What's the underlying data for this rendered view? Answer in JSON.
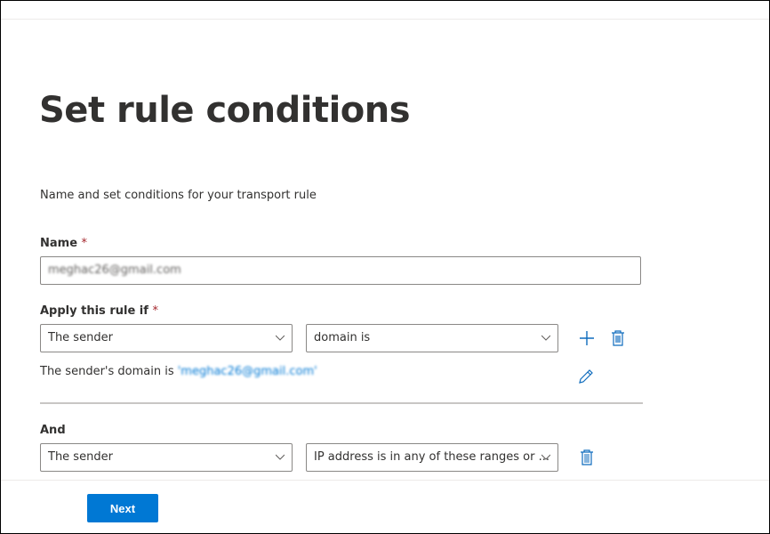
{
  "page": {
    "title": "Set rule conditions",
    "description": "Name and set conditions for your transport rule"
  },
  "name_field": {
    "label": "Name",
    "required": "*",
    "value": "meghac26@gmail.com"
  },
  "apply": {
    "label": "Apply this rule if",
    "required": "*",
    "condition1": "The sender",
    "condition2": "domain is",
    "summary_prefix": "The sender's domain is ",
    "summary_value": "'meghac26@gmail.com'"
  },
  "and": {
    "label": "And",
    "condition1": "The sender",
    "condition2": "IP address is in any of these ranges or ..."
  },
  "footer": {
    "next_label": "Next"
  },
  "colors": {
    "accent": "#0078d4",
    "required": "#a4262c"
  }
}
